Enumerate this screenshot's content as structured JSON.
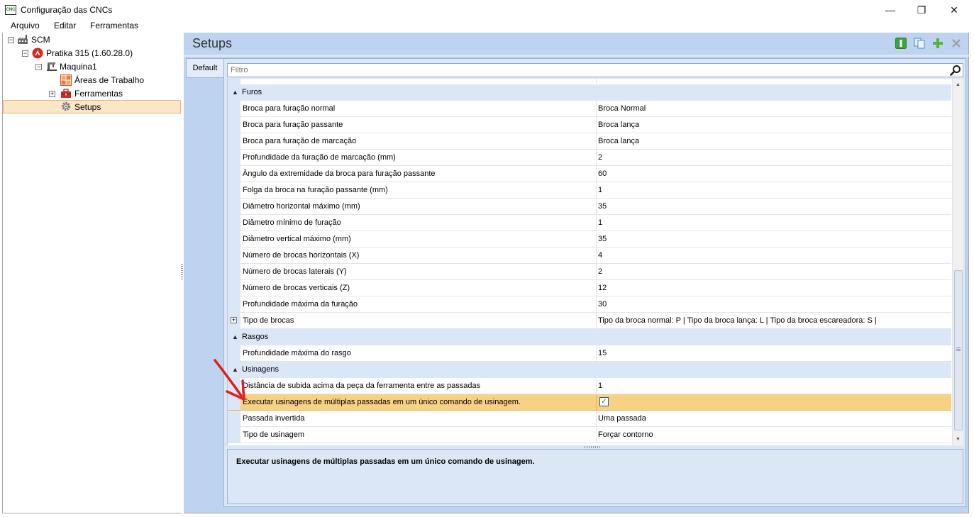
{
  "window": {
    "title": "Configuração das CNCs",
    "icon_text": "CNC",
    "minimize": "—",
    "maximize": "❐",
    "close": "✕"
  },
  "menu": [
    "Arquivo",
    "Editar",
    "Ferramentas"
  ],
  "tree": [
    {
      "label": "SCM",
      "icon": "factory-icon",
      "expander": "−"
    },
    {
      "label": "Pratika 315 (1.60.28.0)",
      "icon": "scm-logo-icon",
      "expander": "−"
    },
    {
      "label": "Maquina1",
      "icon": "machine-icon",
      "expander": "−"
    },
    {
      "label": "Áreas de Trabalho",
      "icon": "work-areas-icon",
      "expander": ""
    },
    {
      "label": "Ferramentas",
      "icon": "toolbox-icon",
      "expander": "+"
    },
    {
      "label": "Setups",
      "icon": "gear-icon",
      "expander": "",
      "selected": true
    }
  ],
  "panel": {
    "title": "Setups",
    "tab": "Default",
    "filter_placeholder": "Filtro",
    "toolbar": [
      "info-icon",
      "copy-icon",
      "add-icon",
      "delete-icon"
    ]
  },
  "grid": {
    "rows": [
      {
        "type": "cat",
        "name": "Furos"
      },
      {
        "type": "prop",
        "name": "Broca para furação normal",
        "value": "Broca Normal"
      },
      {
        "type": "prop",
        "name": "Broca para furação passante",
        "value": "Broca lança"
      },
      {
        "type": "prop",
        "name": "Broca para furação de marcação",
        "value": "Broca lança"
      },
      {
        "type": "prop",
        "name": "Profundidade da furação de marcação (mm)",
        "value": "2"
      },
      {
        "type": "prop",
        "name": "Ângulo da extremidade da broca para furação passante",
        "value": "60"
      },
      {
        "type": "prop",
        "name": "Folga da broca na furação passante (mm)",
        "value": "1"
      },
      {
        "type": "prop",
        "name": "Diâmetro horizontal máximo (mm)",
        "value": "35"
      },
      {
        "type": "prop",
        "name": "Diâmetro mínimo de furação",
        "value": "1"
      },
      {
        "type": "prop",
        "name": "Diâmetro vertical máximo (mm)",
        "value": "35"
      },
      {
        "type": "prop",
        "name": "Número de brocas horizontais (X)",
        "value": "4"
      },
      {
        "type": "prop",
        "name": "Número de brocas laterais (Y)",
        "value": "2"
      },
      {
        "type": "prop",
        "name": "Número de brocas verticais (Z)",
        "value": "12"
      },
      {
        "type": "prop",
        "name": "Profundidade máxima da furação",
        "value": "30"
      },
      {
        "type": "prop",
        "name": "Tipo de brocas",
        "value": "Tipo da broca normal: P  |  Tipo da broca lança: L  |  Tipo da broca escareadora: S  |",
        "expandable": true
      },
      {
        "type": "cat",
        "name": "Rasgos"
      },
      {
        "type": "prop",
        "name": "Profundidade máxima do rasgo",
        "value": "15"
      },
      {
        "type": "cat",
        "name": "Usinagens"
      },
      {
        "type": "prop",
        "name": "Distância de subida acima da peça da ferramenta entre as passadas",
        "value": "1"
      },
      {
        "type": "prop",
        "name": "Executar usinagens de múltiplas passadas em um único comando de usinagem.",
        "checkbox": true,
        "checked": true,
        "selected": true
      },
      {
        "type": "prop",
        "name": "Passada invertida",
        "value": "Uma passada"
      },
      {
        "type": "prop",
        "name": "Tipo de usinagem",
        "value": "Forçar contorno"
      }
    ]
  },
  "description": "Executar usinagens de múltiplas passadas em um único comando de usinagem.",
  "colors": {
    "accent": "#bed3ef",
    "selection": "#f7d184",
    "arrow": "#e02020"
  }
}
